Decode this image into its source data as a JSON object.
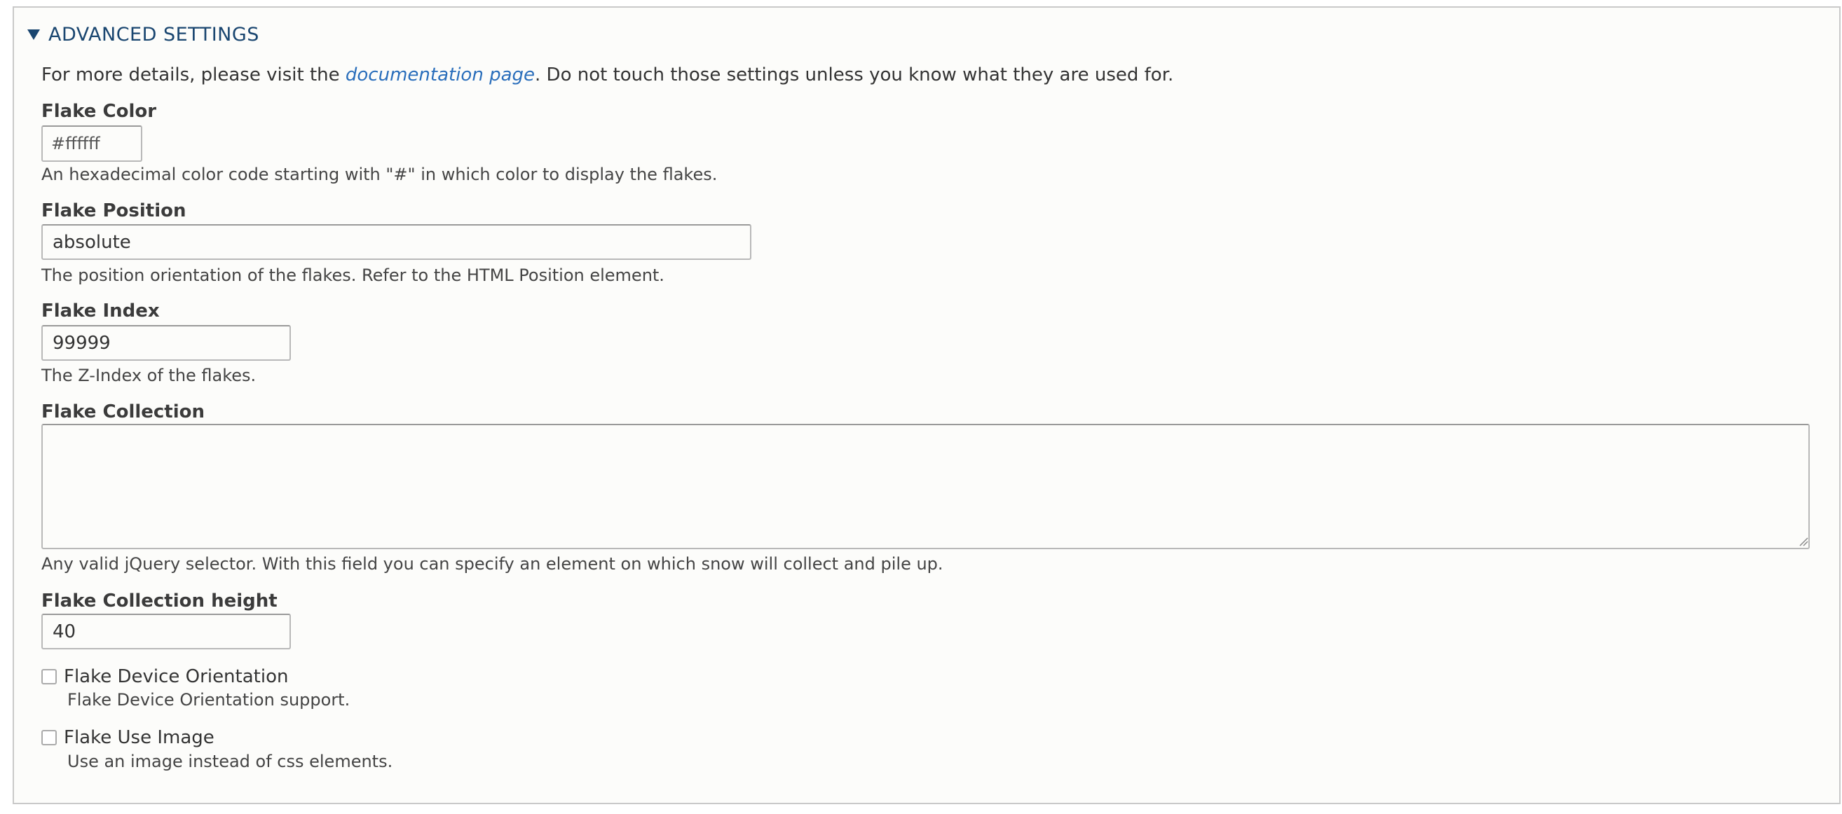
{
  "section": {
    "title": "ADVANCED SETTINGS",
    "description_prefix": "For more details, please visit the ",
    "description_link": "documentation page",
    "description_suffix": ". Do not touch those settings unless you know what they are used for."
  },
  "fields": {
    "flake_color": {
      "label": "Flake Color",
      "value": "#ffffff",
      "help": "An hexadecimal color code starting with \"#\" in which color to display the flakes."
    },
    "flake_position": {
      "label": "Flake Position",
      "value": "absolute",
      "help": "The position orientation of the flakes. Refer to the HTML Position element."
    },
    "flake_index": {
      "label": "Flake Index",
      "value": "99999",
      "help": "The Z-Index of the flakes."
    },
    "flake_collection": {
      "label": "Flake Collection",
      "value": "",
      "help": "Any valid jQuery selector. With this field you can specify an element on which snow will collect and pile up."
    },
    "flake_collection_height": {
      "label": "Flake Collection height",
      "value": "40"
    },
    "flake_device_orientation": {
      "label": "Flake Device Orientation",
      "checked": false,
      "help": "Flake Device Orientation support."
    },
    "flake_use_image": {
      "label": "Flake Use Image",
      "checked": false,
      "help": "Use an image instead of css elements."
    }
  },
  "icons": {
    "toggle": "triangle-down-icon",
    "resize": "resize-grip-icon"
  },
  "colors": {
    "accent": "#1a4670",
    "link": "#2a6ebb",
    "background": "#fcfcfa"
  }
}
